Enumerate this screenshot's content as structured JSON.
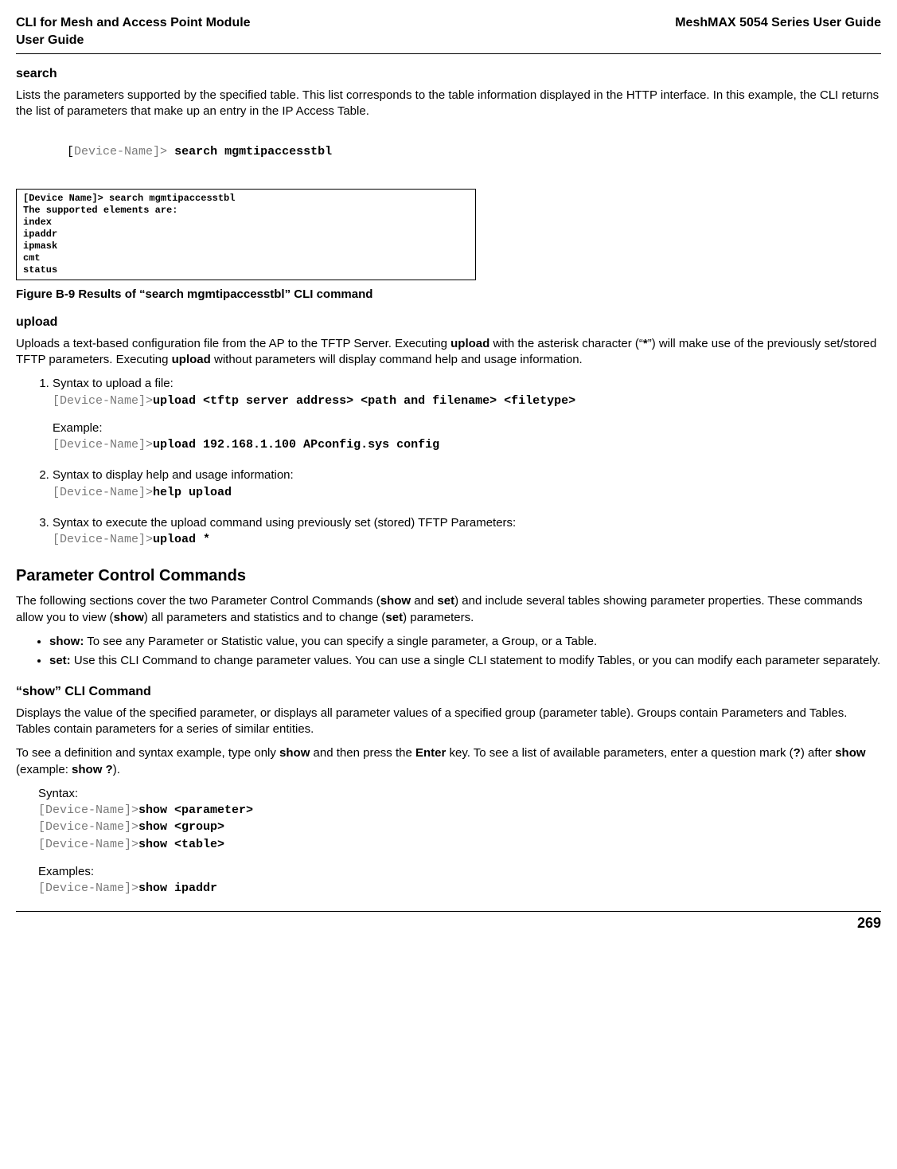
{
  "header": {
    "left": "CLI for Mesh and Access Point Module\n User Guide",
    "right": "MeshMAX 5054 Series User Guide"
  },
  "search": {
    "heading": "search",
    "para": "Lists the parameters supported by the specified table. This list corresponds to the table information displayed in the HTTP interface. In this example, the CLI returns the list of parameters that make up an entry in the IP Access Table.",
    "cmd_prefix": "[",
    "cmd_gray": "Device-Name]>",
    "cmd_bold": " search mgmtipaccesstbl",
    "figbox": "[Device Name]> search mgmtipaccesstbl\nThe supported elements are:\nindex\nipaddr\nipmask\ncmt\nstatus",
    "figcaption": "Figure B-9 Results of “search mgmtipaccesstbl” CLI command"
  },
  "upload": {
    "heading": "upload",
    "para_a": "Uploads a text-based configuration file from the AP to the TFTP Server. Executing ",
    "para_b_bold1": "upload",
    "para_c": " with the asterisk character (“",
    "para_d_bold2": "*",
    "para_e": "”) will make use of the previously set/stored TFTP parameters. Executing ",
    "para_f_bold3": "upload",
    "para_g": " without parameters will display command help and usage information.",
    "items": {
      "n1": {
        "text": "Syntax to upload a file:",
        "code_gray": "[Device-Name]>",
        "code_bold": "upload <tftp server address> <path and filename> <filetype>",
        "ex_label": "Example:",
        "ex_gray": "[Device-Name]>",
        "ex_bold": "upload 192.168.1.100 APconfig.sys config"
      },
      "n2": {
        "text": "Syntax to display help and usage information:",
        "code_gray": "[Device-Name]>",
        "code_bold": "help upload"
      },
      "n3": {
        "text": "Syntax to execute the upload command using previously set (stored) TFTP Parameters:",
        "code_gray": "[Device-Name]>",
        "code_bold": "upload *"
      }
    }
  },
  "pcc": {
    "heading": "Parameter Control Commands",
    "para_a": "The following sections cover the two Parameter Control Commands (",
    "para_b_bold1": "show",
    "para_c": " and ",
    "para_d_bold2": "set",
    "para_e": ") and include several tables showing parameter properties. These commands allow you to view (",
    "para_f_bold3": "show",
    "para_g": ") all parameters and statistics and to change (",
    "para_h_bold4": "set",
    "para_i": ") parameters.",
    "bullets": {
      "b1": {
        "label": "show:",
        "text": " To see any Parameter or Statistic value, you can specify a single parameter, a Group, or a Table."
      },
      "b2": {
        "label": "set:",
        "text": " Use this CLI Command to change parameter values. You can use a single CLI statement to modify Tables, or you can modify each parameter separately."
      }
    }
  },
  "showcmd": {
    "heading": "“show” CLI Command",
    "para1": "Displays the value of the specified parameter, or displays all parameter values of a specified group (parameter table). Groups contain Parameters and Tables. Tables contain parameters for a series of similar entities.",
    "para2_a": "To see a definition and syntax example, type only ",
    "para2_b_bold1": "show",
    "para2_c": " and then press the ",
    "para2_d_bold2": "Enter",
    "para2_e": " key. To see a list of available parameters, enter a question mark (",
    "para2_f_bold3": "?",
    "para2_g": ") after ",
    "para2_h_bold4": "show",
    "para2_i": " (example: ",
    "para2_j_bold5": "show ?",
    "para2_k": ").",
    "syntax_label": "Syntax:",
    "s1_gray": "[Device-Name]>",
    "s1_bold": "show <parameter>",
    "s2_gray": "[Device-Name]>",
    "s2_bold": "show <group>",
    "s3_gray": "[Device-Name]>",
    "s3_bold": "show <table>",
    "ex_label": "Examples:",
    "e1_gray": "[Device-Name]>",
    "e1_bold": "show ipaddr"
  },
  "footer": {
    "page": "269"
  }
}
